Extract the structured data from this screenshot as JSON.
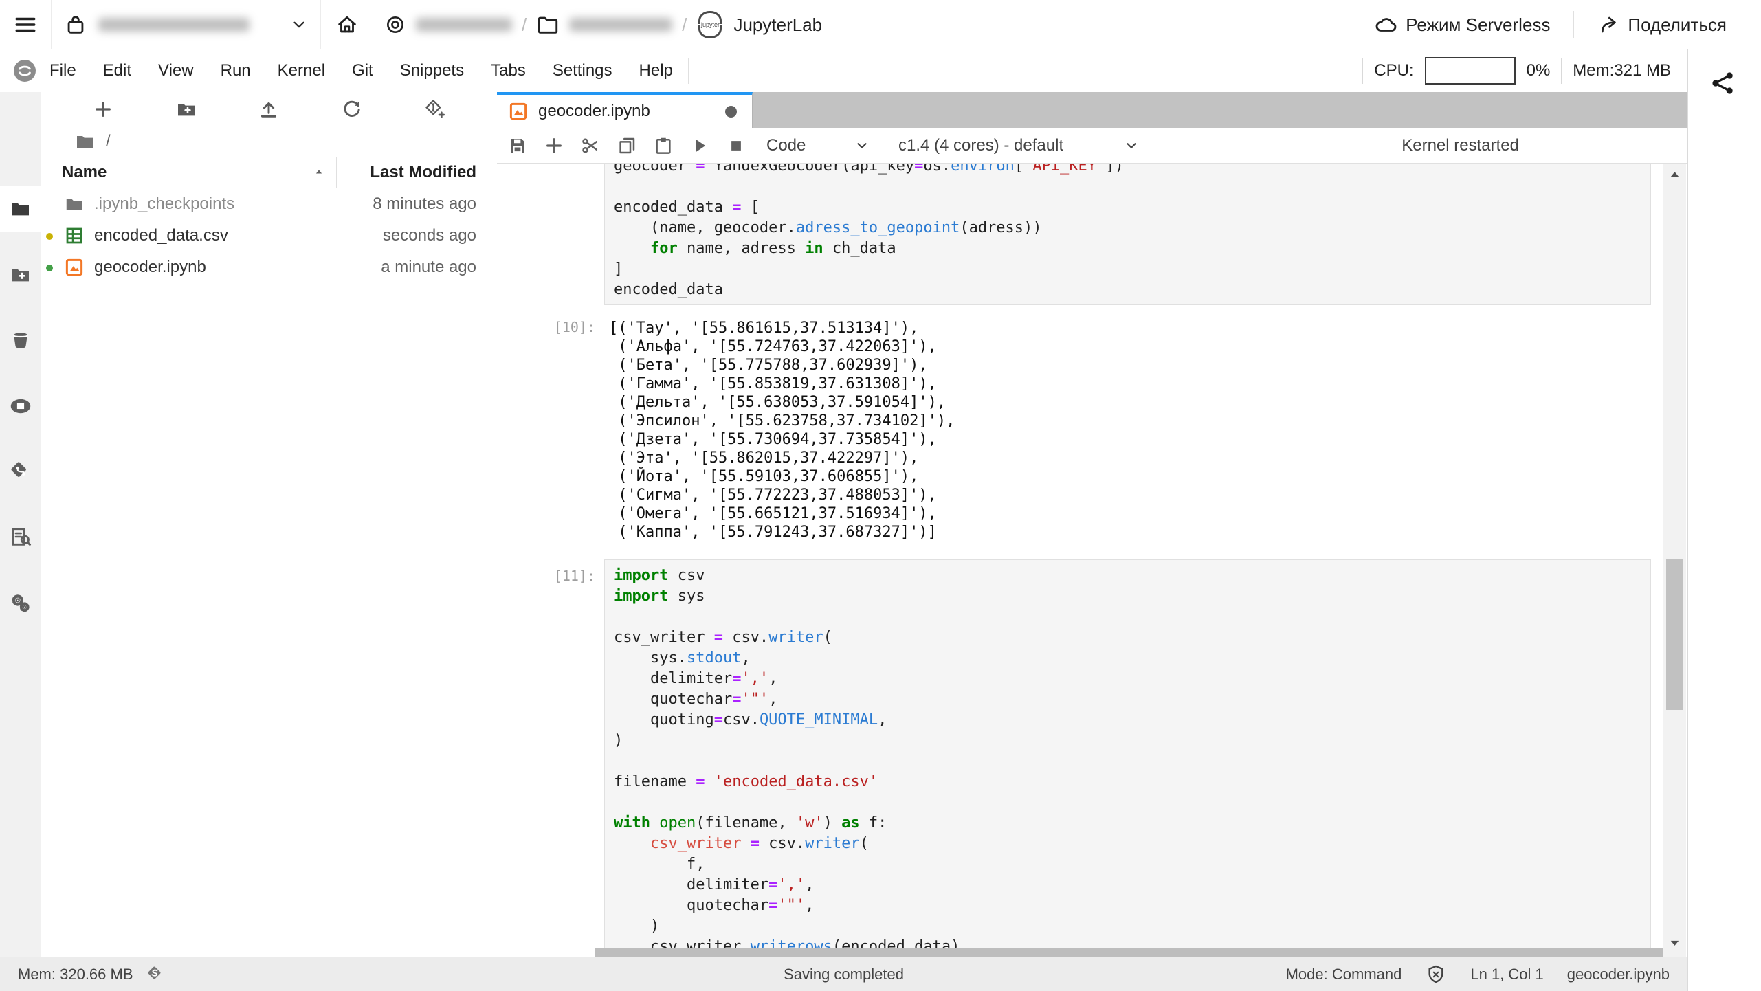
{
  "topbar": {
    "jupyterlab_label": "JupyterLab",
    "breadcrumb_separator": "/",
    "serverless_label": "Режим Serverless",
    "share_label": "Поделиться"
  },
  "menubar": {
    "items": [
      "File",
      "Edit",
      "View",
      "Run",
      "Kernel",
      "Git",
      "Snippets",
      "Tabs",
      "Settings",
      "Help"
    ],
    "cpu_label": "CPU:",
    "cpu_value": "0%",
    "mem_label": "Mem:321 MB"
  },
  "sidebar": {
    "items": [
      {
        "name": "file-browser",
        "icon": "folder-fill",
        "active": true
      },
      {
        "name": "storage-new",
        "icon": "folder-plus"
      },
      {
        "name": "bucket",
        "icon": "bucket"
      },
      {
        "name": "sessions",
        "icon": "container"
      },
      {
        "name": "git",
        "icon": "git-diamond"
      },
      {
        "name": "catalog",
        "icon": "catalog"
      },
      {
        "name": "extensions",
        "icon": "gears"
      }
    ]
  },
  "filebrowser": {
    "toolbar": [
      {
        "name": "new-launcher-button",
        "icon": "plus"
      },
      {
        "name": "new-folder-button",
        "icon": "folder-plus"
      },
      {
        "name": "upload-button",
        "icon": "upload"
      },
      {
        "name": "refresh-button",
        "icon": "refresh"
      },
      {
        "name": "git-clone-button",
        "icon": "git-plus"
      }
    ],
    "breadcrumb_root": "/",
    "columns": {
      "name": "Name",
      "modified": "Last Modified"
    },
    "items": [
      {
        "name": ".ipynb_checkpoints",
        "modified": "8 minutes ago",
        "icon": "folder-fill",
        "dim": true,
        "marker": ""
      },
      {
        "name": "encoded_data.csv",
        "modified": "seconds ago",
        "icon": "csv",
        "dim": false,
        "marker": "#c9b204"
      },
      {
        "name": "geocoder.ipynb",
        "modified": "a minute ago",
        "icon": "nb-orange",
        "dim": false,
        "marker": "#43a047"
      }
    ]
  },
  "notebook": {
    "tab": {
      "title": "geocoder.ipynb",
      "dirty": true
    },
    "toolbar": {
      "icons": [
        {
          "name": "save-button",
          "icon": "save"
        },
        {
          "name": "add-cell-button",
          "icon": "plus"
        },
        {
          "name": "cut-cell-button",
          "icon": "cut"
        },
        {
          "name": "copy-cell-button",
          "icon": "copy"
        },
        {
          "name": "paste-cell-button",
          "icon": "paste"
        },
        {
          "name": "run-button",
          "icon": "run"
        },
        {
          "name": "stop-button",
          "icon": "stop"
        }
      ],
      "cell_type": "Code",
      "kernel": "c1.4 (4 cores) - default",
      "status": "Kernel restarted"
    },
    "cells": [
      {
        "kind": "code",
        "id": "cell0",
        "prompt": "",
        "lines": [
          [
            [
              "geocoder ",
              "pl"
            ],
            [
              "=",
              "op"
            ],
            [
              " YandexGeocoder(api_key",
              "pl"
            ],
            [
              "=",
              "op"
            ],
            [
              "os.",
              "pl"
            ],
            [
              "environ",
              "prop"
            ],
            [
              "[",
              "pl"
            ],
            [
              "'API_KEY'",
              "str"
            ],
            [
              "])",
              "pl"
            ]
          ],
          "",
          [
            [
              "encoded_data ",
              "pl"
            ],
            [
              "=",
              "op"
            ],
            [
              " [",
              "pl"
            ]
          ],
          [
            [
              "    (name, geocoder.",
              "pl"
            ],
            [
              "adress_to_geopoint",
              "prop"
            ],
            [
              "(adress))",
              "pl"
            ]
          ],
          [
            [
              "    ",
              "pl"
            ],
            [
              "for",
              "kw"
            ],
            [
              " name, adress ",
              "pl"
            ],
            [
              "in",
              "kw"
            ],
            [
              " ch_data",
              "pl"
            ]
          ],
          [
            [
              "]",
              "pl"
            ]
          ],
          [
            [
              "encoded_data",
              "pl"
            ]
          ]
        ]
      },
      {
        "kind": "output",
        "id": "out0",
        "prompt": "[10]:",
        "lines": [
          "[('Тау', '[55.861615,37.513134]'),",
          " ('Альфа', '[55.724763,37.422063]'),",
          " ('Бета', '[55.775788,37.602939]'),",
          " ('Гамма', '[55.853819,37.631308]'),",
          " ('Дельта', '[55.638053,37.591054]'),",
          " ('Эпсилон', '[55.623758,37.734102]'),",
          " ('Дзета', '[55.730694,37.735854]'),",
          " ('Эта', '[55.862015,37.422297]'),",
          " ('Йота', '[55.59103,37.606855]'),",
          " ('Сигма', '[55.772223,37.488053]'),",
          " ('Омега', '[55.665121,37.516934]'),",
          " ('Каппа', '[55.791243,37.687327]')]"
        ]
      },
      {
        "kind": "code",
        "id": "cell2",
        "prompt": "[11]:",
        "lines": [
          [
            [
              "import",
              "kw"
            ],
            [
              " csv",
              "pl"
            ]
          ],
          [
            [
              "import",
              "kw"
            ],
            [
              " sys",
              "pl"
            ]
          ],
          "",
          [
            [
              "csv_writer ",
              "pl"
            ],
            [
              "=",
              "op"
            ],
            [
              " csv.",
              "pl"
            ],
            [
              "writer",
              "prop"
            ],
            [
              "(",
              "pl"
            ]
          ],
          [
            [
              "    sys.",
              "pl"
            ],
            [
              "stdout",
              "prop"
            ],
            [
              ",",
              "pl"
            ]
          ],
          [
            [
              "    delimiter",
              "pl"
            ],
            [
              "=",
              "op"
            ],
            [
              "','",
              "str"
            ],
            [
              ",",
              "pl"
            ]
          ],
          [
            [
              "    quotechar",
              "pl"
            ],
            [
              "=",
              "op"
            ],
            [
              "'\"'",
              "str"
            ],
            [
              ",",
              "pl"
            ]
          ],
          [
            [
              "    quoting",
              "pl"
            ],
            [
              "=",
              "op"
            ],
            [
              "csv.",
              "pl"
            ],
            [
              "QUOTE_MINIMAL",
              "prop"
            ],
            [
              ",",
              "pl"
            ]
          ],
          [
            [
              ")",
              "pl"
            ]
          ],
          "",
          [
            [
              "filename ",
              "pl"
            ],
            [
              "=",
              "op"
            ],
            [
              " ",
              "pl"
            ],
            [
              "'encoded_data.csv'",
              "str"
            ]
          ],
          "",
          [
            [
              "with",
              "kw"
            ],
            [
              " ",
              "pl"
            ],
            [
              "open",
              "bi"
            ],
            [
              "(filename, ",
              "pl"
            ],
            [
              "'w'",
              "str"
            ],
            [
              ") ",
              "pl"
            ],
            [
              "as",
              "kw"
            ],
            [
              " f:",
              "pl"
            ]
          ],
          [
            [
              "    ",
              "pl"
            ],
            [
              "csv_writer",
              "v2"
            ],
            [
              " ",
              "pl"
            ],
            [
              "=",
              "op"
            ],
            [
              " csv.",
              "pl"
            ],
            [
              "writer",
              "prop"
            ],
            [
              "(",
              "pl"
            ]
          ],
          [
            [
              "        f,",
              "pl"
            ]
          ],
          [
            [
              "        delimiter",
              "pl"
            ],
            [
              "=",
              "op"
            ],
            [
              "','",
              "str"
            ],
            [
              ",",
              "pl"
            ]
          ],
          [
            [
              "        quotechar",
              "pl"
            ],
            [
              "=",
              "op"
            ],
            [
              "'\"'",
              "str"
            ],
            [
              ",",
              "pl"
            ]
          ],
          [
            [
              "    )",
              "pl"
            ]
          ],
          [
            [
              "    csv_writer.",
              "pl"
            ],
            [
              "writerows",
              "prop"
            ],
            [
              "(encoded_data)",
              "pl"
            ]
          ]
        ]
      }
    ]
  },
  "statusbar": {
    "mem": "Mem: 320.66 MB",
    "saving": "Saving completed",
    "mode": "Mode: Command",
    "position": "Ln 1, Col 1",
    "file": "geocoder.ipynb"
  },
  "colors": {
    "accent_blue": "#2196f3",
    "notebook_orange": "#f37726",
    "csv_green": "#2e7d32",
    "git_modified_green": "#43a047",
    "git_untracked_yellow": "#c9b204"
  }
}
